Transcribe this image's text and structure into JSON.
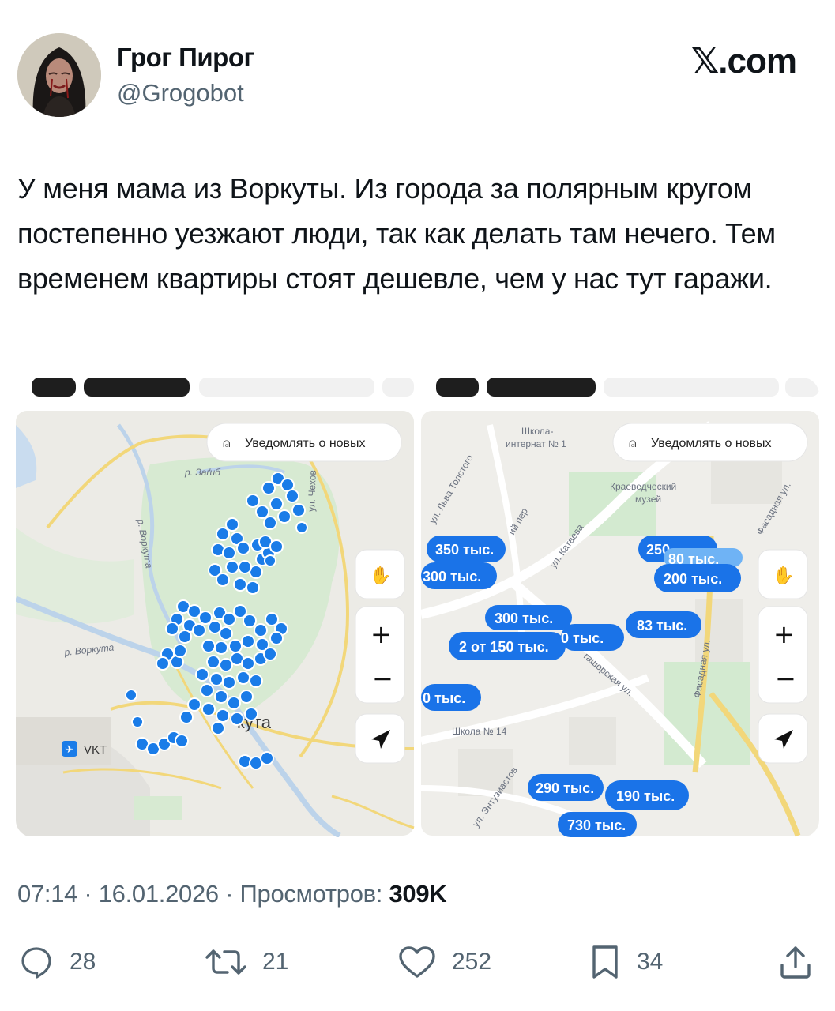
{
  "author": {
    "display_name": "Грог Пирог",
    "handle": "@Grogobot",
    "avatar_icon": "avatar-portrait"
  },
  "brand": "𝕏.com",
  "tweet": {
    "text": "У меня мама из Воркуты. Из города за полярным кругом постепенно уезжают люди, так как делать там нечего. Тем временем квартиры стоят дешевле, чем у нас тут гаражи."
  },
  "maps": {
    "notify_label": "Уведомлять о новых",
    "left": {
      "labels": {
        "river_zagib": "р. Заґиб",
        "river_vorkuta_vertical": "р. Воркута",
        "river_vorkuta": "р. Воркута",
        "street_chekhov": "ул. Чехов",
        "city": "кута",
        "airport": "VKT"
      }
    },
    "right": {
      "labels": {
        "school_1a": "Школа-",
        "school_1b": "интернат № 1",
        "museum_a": "Краеведческий",
        "museum_b": "музей",
        "tolstoy": "ул. Льва Толстого",
        "kataeva": "ул. Катаева",
        "lane": "ий пер.",
        "shakhtyorskaya": "гашорская ул.",
        "fasadnaya_1": "Фасадная ул.",
        "fasadnaya_2": "Фасадная ул.",
        "school_14": "Школа № 14",
        "entuziastov": "ул. Энтузиастов"
      },
      "prices": [
        "350 тыс.",
        "300 тыс.",
        "250",
        "80 тыс.",
        "200 тыс.",
        "300 тыс.",
        "2 от 150 тыс.",
        "0 тыс.",
        "83 тыс.",
        "0 тыс.",
        "290 тыс.",
        "190 тыс.",
        "730 тыс."
      ]
    },
    "pin_color": "#1a7ce8",
    "accent_price_color": "#1a73e8"
  },
  "meta": {
    "time_date_views_prefix": "07:14 · 16.01.2026 · Просмотров: ",
    "views": "309K"
  },
  "actions": {
    "replies": "28",
    "retweets": "21",
    "likes": "252",
    "bookmarks": "34"
  }
}
